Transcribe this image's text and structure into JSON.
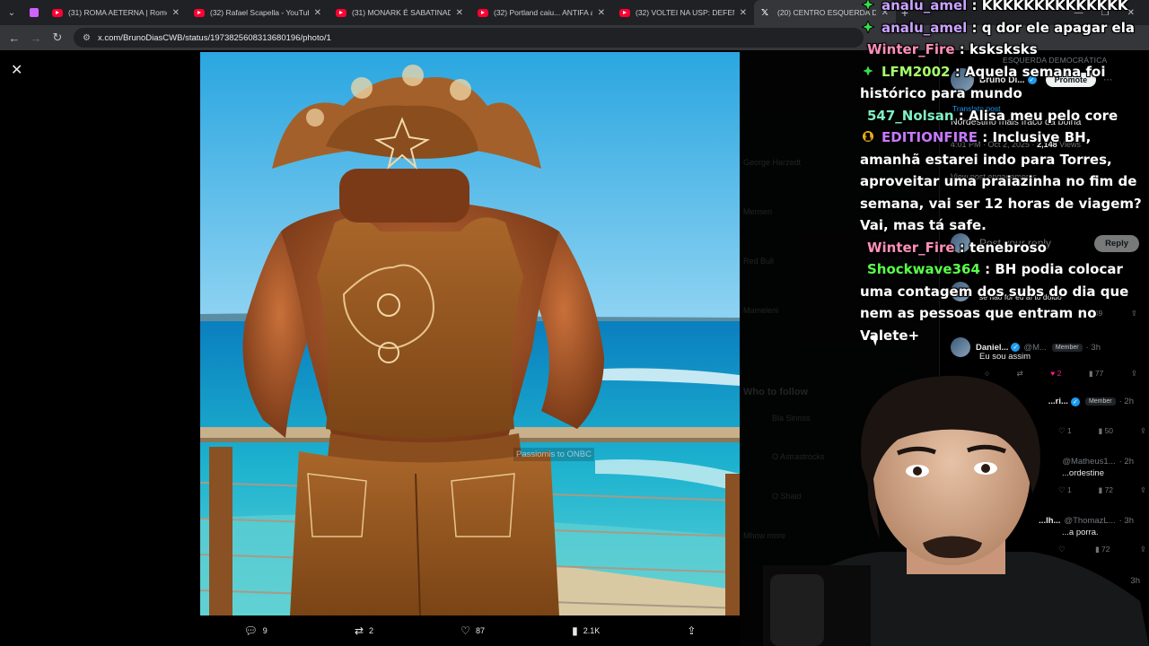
{
  "browser": {
    "tabs": [
      {
        "title": "(31) ROMA AETERNA | Rome",
        "type": "youtube"
      },
      {
        "title": "(32) Rafael Scapella - YouTube",
        "type": "youtube"
      },
      {
        "title": "(31) MONARK É SABATINADO",
        "type": "youtube"
      },
      {
        "title": "(32) Portland caiu... ANTIFA ass",
        "type": "youtube"
      },
      {
        "title": "(32) VOLTEI NA USP: DEFENDI",
        "type": "youtube"
      },
      {
        "title": "(20) CENTRO ESQUERDA DEMO",
        "type": "x",
        "active": true
      }
    ],
    "url": "x.com/BrunoDiasCWB/status/1973825608313680196/photo/1"
  },
  "viewer": {
    "watermark": "Passiomis to ONBC",
    "actions": {
      "replies": "9",
      "reposts": "2",
      "likes": "87",
      "views": "2.1K"
    }
  },
  "side_blurred": {
    "items": [
      "George Harzedt",
      "Mensen",
      "Red Bull",
      "Mameleni",
      "Who to follow",
      "Bla Sinnss",
      "O Astrastrocks",
      "O Shaid",
      "Mhow more"
    ]
  },
  "post": {
    "community": "ESQUERDA DEMOCRÁTICA",
    "author_name": "Bruno Di...",
    "promote_label": "Promote",
    "translate_label": "Translate post",
    "text": "Nordestino mais fraco da bolha",
    "meta_time": "4:01 PM · Oct 2, 2025 ·",
    "meta_views": "2,148",
    "meta_views_label": "Views",
    "engagements_label": "View post engagements",
    "reply_placeholder": "Post your reply",
    "reply_button": "Reply"
  },
  "replies": [
    {
      "name": "",
      "handle": "",
      "time": "",
      "badge": "",
      "text": "se não for eu aí to doido",
      "counts": [
        "",
        "",
        "",
        "49",
        ""
      ]
    },
    {
      "name": "Daniel...",
      "handle": "@M...",
      "badge": "Member",
      "time": "· 3h",
      "text": "Eu sou assim",
      "counts": [
        "",
        "",
        "2",
        "77",
        ""
      ]
    },
    {
      "name": "...ri...",
      "handle": "",
      "badge": "Member",
      "time": "· 2h",
      "text": "",
      "counts": [
        "",
        "",
        "1",
        "50",
        ""
      ]
    },
    {
      "name": "",
      "handle": "@Matheus1...",
      "badge": "",
      "time": "· 2h",
      "text": "...ordestine",
      "counts": [
        "",
        "",
        "1",
        "72",
        ""
      ]
    },
    {
      "name": "...lh...",
      "handle": "@ThomazL...",
      "badge": "",
      "time": "· 3h",
      "text": "...a porra.",
      "counts": [
        "",
        "",
        "",
        "72",
        ""
      ]
    }
  ],
  "reply_last_time": "3h",
  "chat": [
    {
      "user": "analu_amel",
      "color": "#c9a3ff",
      "badge": "sparkle-green",
      "text": "KKKKKKKKKKKKKK"
    },
    {
      "user": "analu_amel",
      "color": "#c9a3ff",
      "badge": "sparkle-green",
      "text": "q dor ele apagar ela"
    },
    {
      "user": "Winter_Fire",
      "color": "#ff8fb8",
      "badge": "",
      "text": "ksksksks"
    },
    {
      "user": "LFM2002",
      "color": "#a6ff6a",
      "badge": "sparkle-green",
      "text": "Aquela semana foi histórico para mundo"
    },
    {
      "user": "547_Nolsan",
      "color": "#7ff0c4",
      "badge": "",
      "text": "Alisa meu pelo core"
    },
    {
      "user": "EDITIONFIRE",
      "color": "#c779ff",
      "badge": "gold-1",
      "text": "Inclusive BH, amanhã estarei indo para Torres, aproveitar uma praiazinha no fim de semana, vai ser 12 horas de viagem? Vai, mas tá safe."
    },
    {
      "user": "Winter_Fire",
      "color": "#ff8fb8",
      "badge": "",
      "text": "tenebroso"
    },
    {
      "user": "Shockwave364",
      "color": "#59ff4a",
      "badge": "",
      "text": "BH podia colocar uma contagem dos subs do dia que nem as pessoas que entram no Valete+"
    }
  ]
}
